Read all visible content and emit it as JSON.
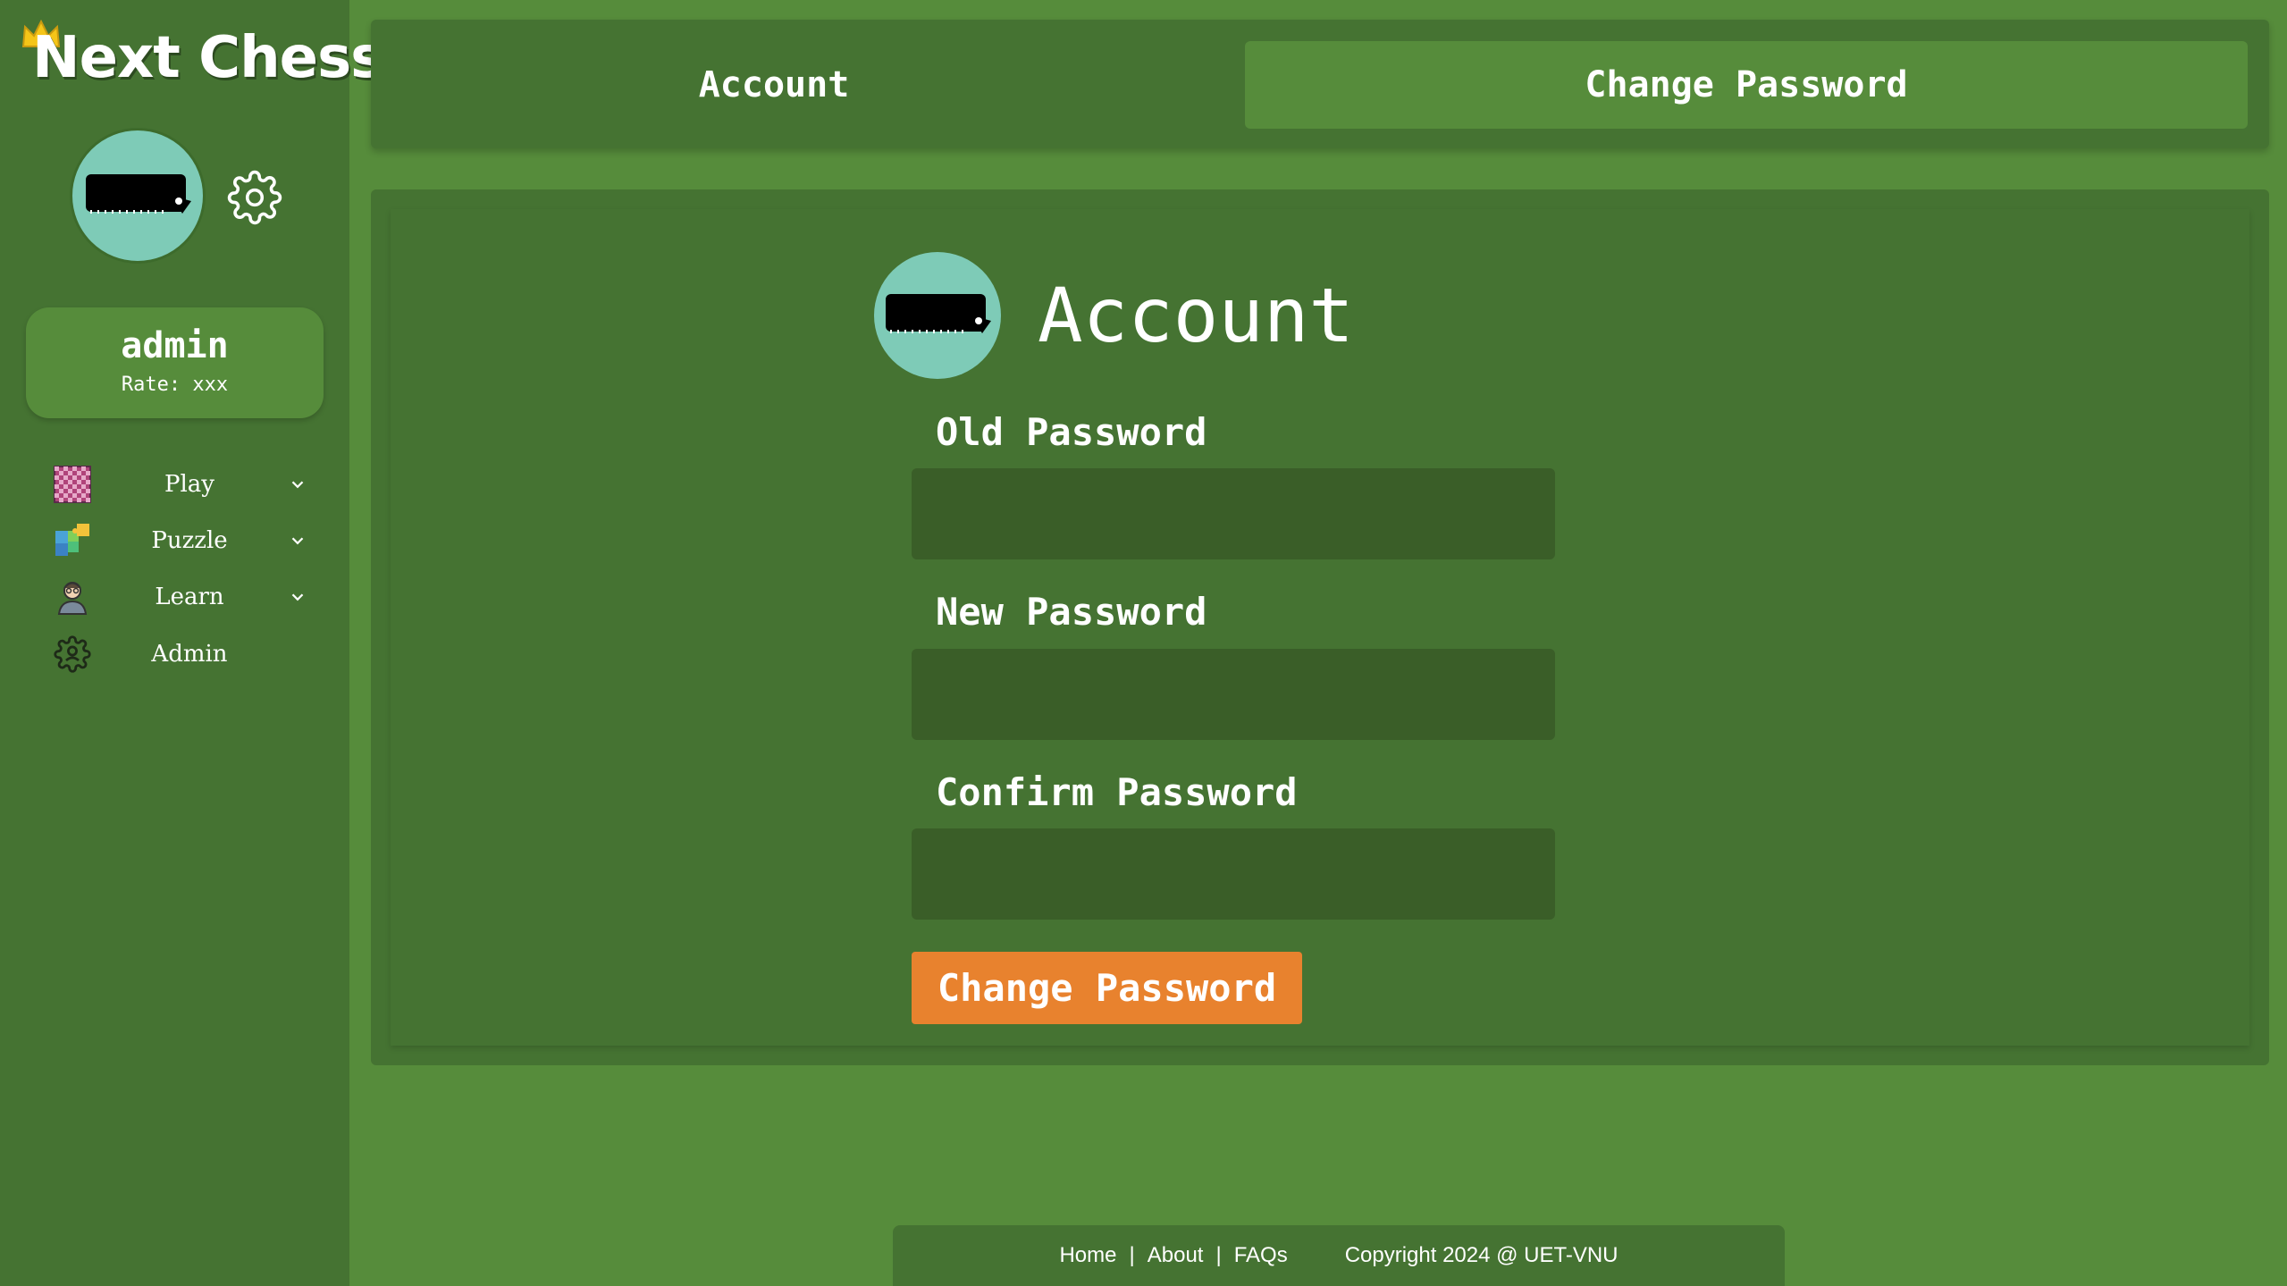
{
  "app": {
    "logo_text": "Next Chess"
  },
  "sidebar": {
    "user": {
      "name": "admin",
      "rate_text": "Rate: xxx"
    },
    "items": [
      {
        "label": "Play",
        "icon": "chessboard-icon",
        "has_dropdown": true
      },
      {
        "label": "Puzzle",
        "icon": "puzzle-icon",
        "has_dropdown": true
      },
      {
        "label": "Learn",
        "icon": "teacher-icon",
        "has_dropdown": true
      },
      {
        "label": "Admin",
        "icon": "admin-gear-icon",
        "has_dropdown": false
      }
    ]
  },
  "tabs": [
    {
      "label": "Account",
      "active": false
    },
    {
      "label": "Change Password",
      "active": true
    }
  ],
  "form": {
    "title": "Account",
    "fields": [
      {
        "label": "Old Password",
        "value": "",
        "placeholder": ""
      },
      {
        "label": "New Password",
        "value": "",
        "placeholder": ""
      },
      {
        "label": "Confirm Password",
        "value": "",
        "placeholder": ""
      }
    ],
    "submit_label": "Change Password"
  },
  "footer": {
    "links": [
      "Home",
      "About",
      "FAQs"
    ],
    "separator": "|",
    "copyright": "Copyright 2024 @ UET-VNU"
  },
  "colors": {
    "background": "#568c3b",
    "panel": "#457332",
    "input": "#3a5e28",
    "accent": "#e8822e",
    "avatar": "#7ecbb7"
  }
}
